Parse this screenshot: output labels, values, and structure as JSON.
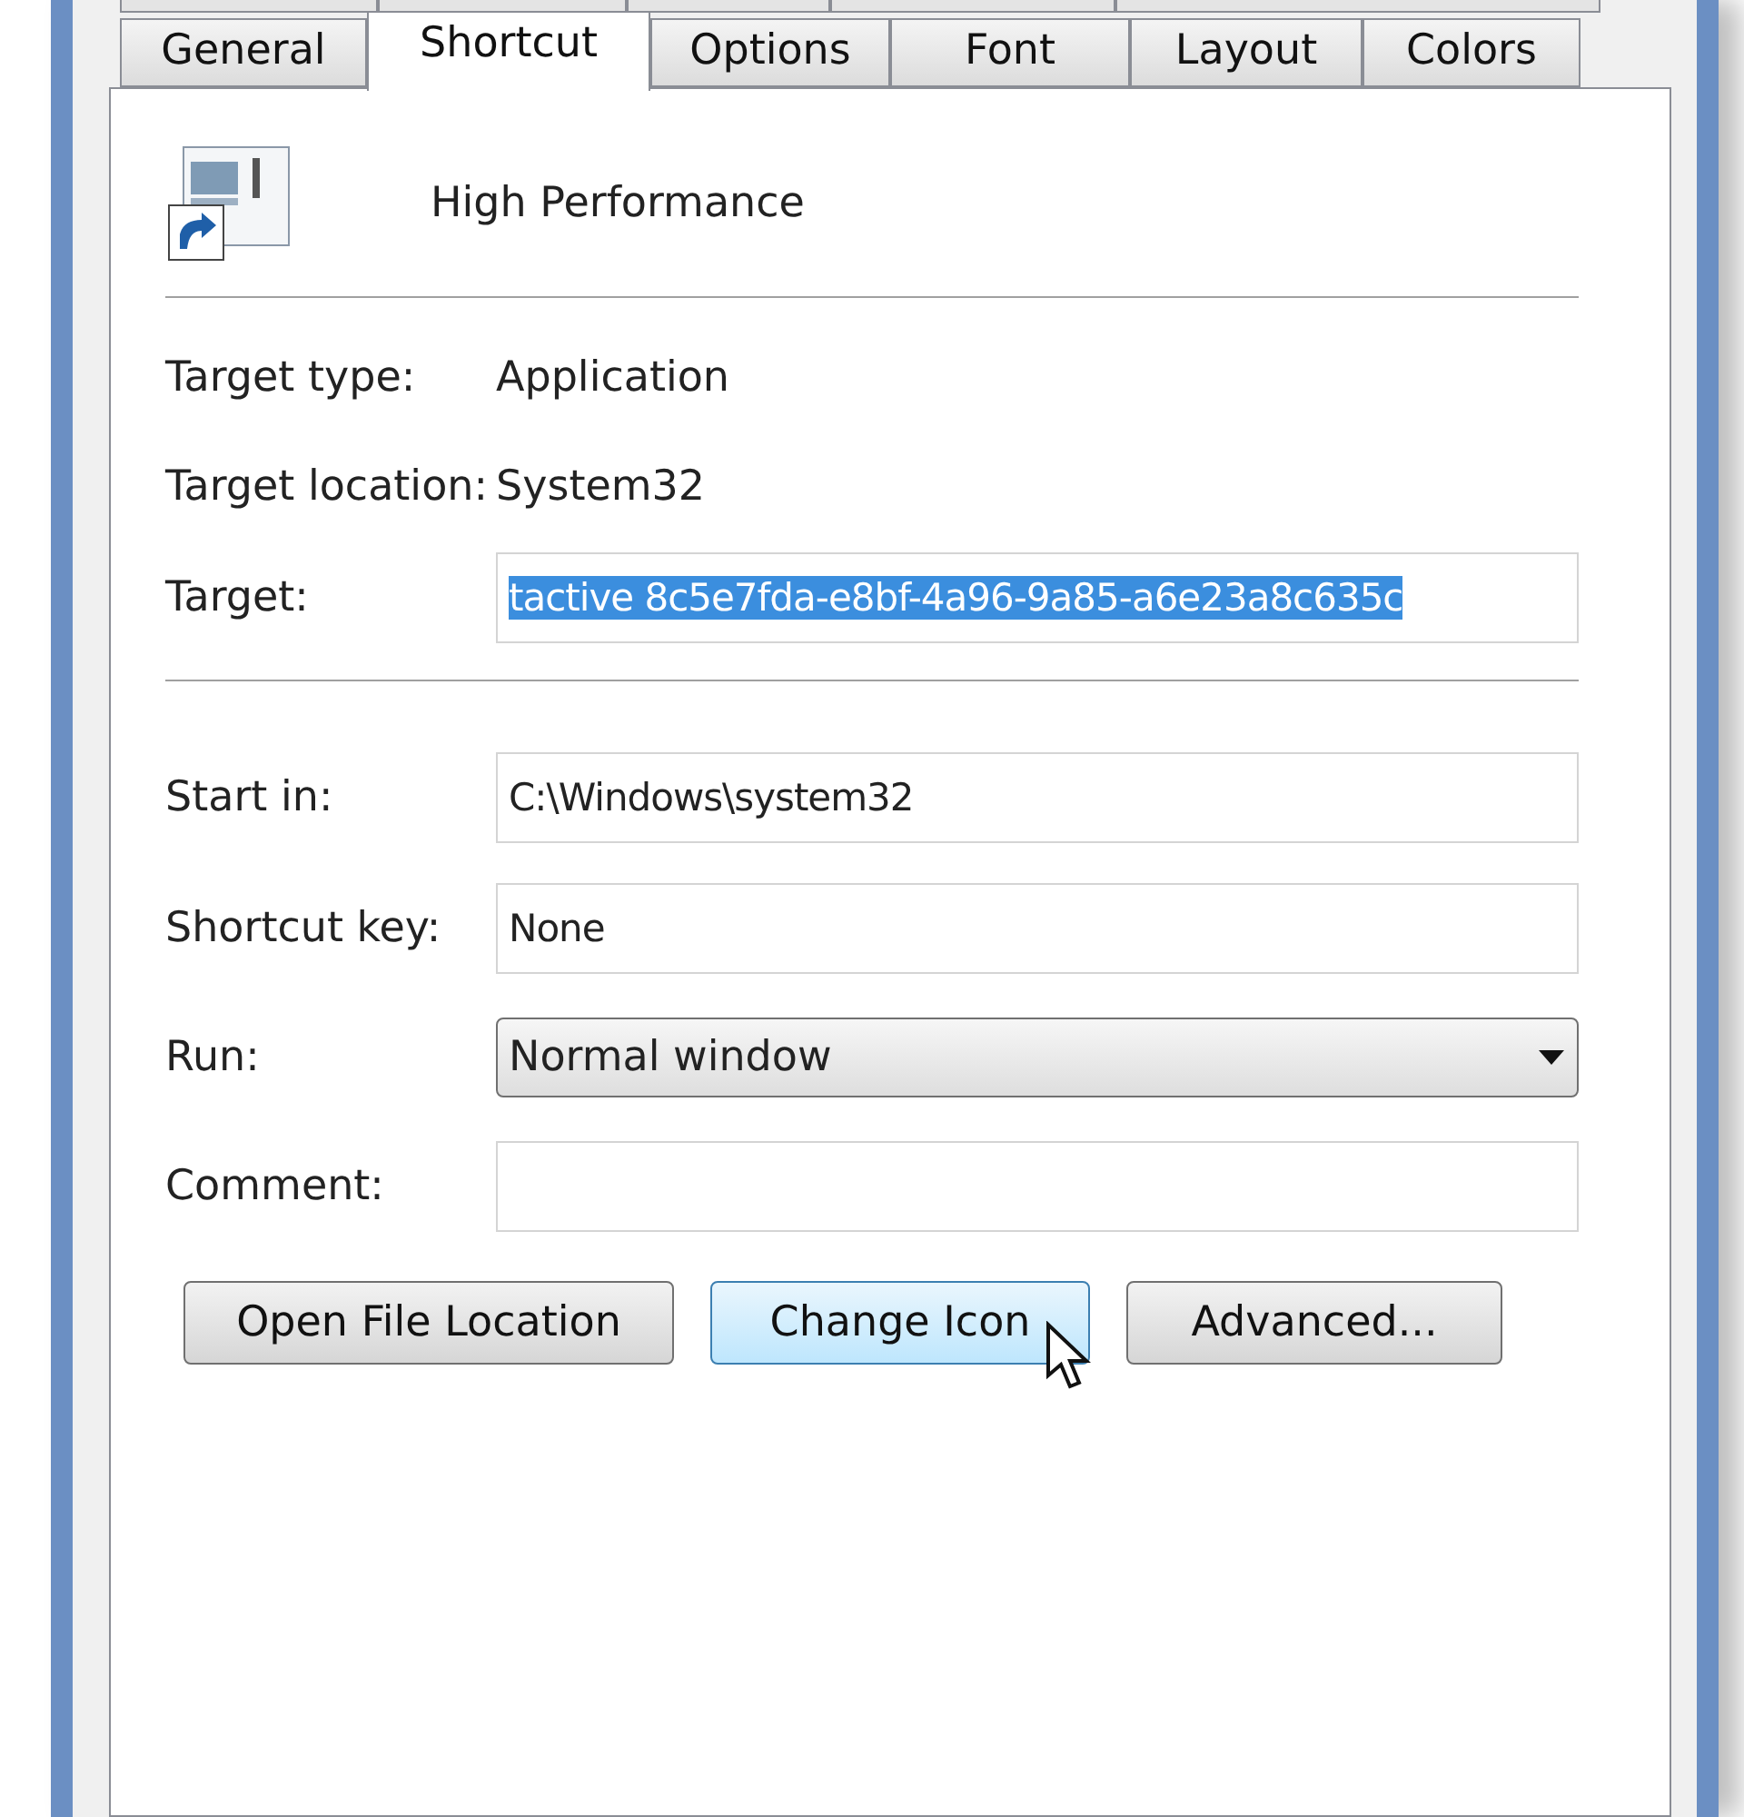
{
  "tabs": [
    {
      "label": "General",
      "selected": false
    },
    {
      "label": "Shortcut",
      "selected": true
    },
    {
      "label": "Options",
      "selected": false
    },
    {
      "label": "Font",
      "selected": false
    },
    {
      "label": "Layout",
      "selected": false
    },
    {
      "label": "Colors",
      "selected": false
    }
  ],
  "shortcut": {
    "name": "High Performance"
  },
  "info": [
    {
      "kind": "text",
      "label": "Target type:",
      "value": "Application"
    },
    {
      "kind": "text",
      "label": "Target location:",
      "value": "System32"
    },
    {
      "kind": "input",
      "label": "Target:",
      "value": "tactive 8c5e7fda-e8bf-4a96-9a85-a6e23a8c635c",
      "selected": true
    }
  ],
  "fields": [
    {
      "kind": "input",
      "label": "Start in:",
      "value": "C:\\Windows\\system32"
    },
    {
      "kind": "input",
      "label": "Shortcut key:",
      "value": "None"
    },
    {
      "kind": "dropdown",
      "label": "Run:",
      "value": "Normal window"
    },
    {
      "kind": "input",
      "label": "Comment:"
    }
  ],
  "buttons": [
    {
      "label": "Open File Location",
      "hovered": false
    },
    {
      "label": "Change Icon",
      "hovered": true
    },
    {
      "label": "Advanced...",
      "hovered": false
    }
  ]
}
